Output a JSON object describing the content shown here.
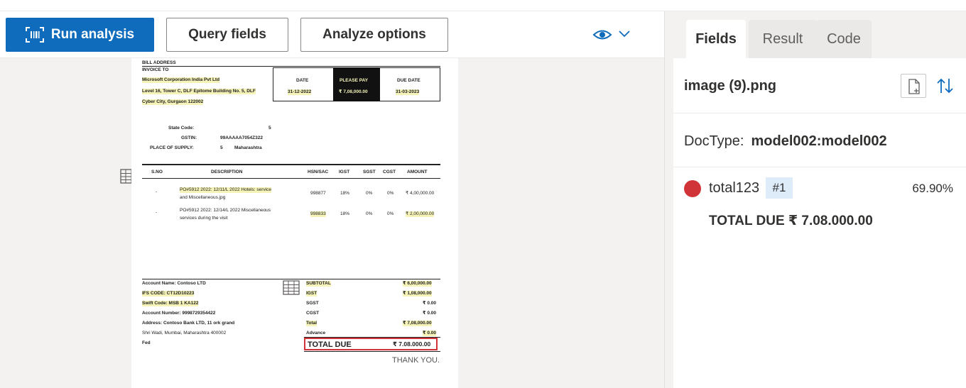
{
  "toolbar": {
    "run_label": "Run analysis",
    "query_label": "Query fields",
    "options_label": "Analyze options"
  },
  "document": {
    "header_small": "BILL ADDRESS",
    "invoice_to": "INVOICE TO",
    "company_line1": "Microsoft Corporation India Pvt Ltd",
    "company_line2": "Level 16, Tower C, DLF Epitome Building No. 5, DLF",
    "company_line3": "Cyber City, Gurgaon 122002",
    "date_label": "DATE",
    "please_pay_label": "PLEASE PAY",
    "due_date_label": "DUE DATE",
    "date_value": "31-12-2022",
    "please_pay_value": "₹ 7,08,000.00",
    "due_date_value": "31-03-2023",
    "state_code_label": "State Code:",
    "state_code_value": "5",
    "gstin_label": "GSTIN:",
    "gstin_value": "99AAAAA7054Z322",
    "place_label": "PLACE OF SUPPLY:",
    "place_code": "5",
    "place_value": "Maharashtra",
    "col_sno": "S.NO",
    "col_desc": "DESCRIPTION",
    "col_hsn": "HSN/SAC",
    "col_igst": "IGST",
    "col_sgst": "SGST",
    "col_cgst": "CGST",
    "col_amount": "AMOUNT",
    "item1_desc1": "PO#5912 2022: 12/11/L 2022 Hotels: service",
    "item1_desc2": "and Miscellaneous.jpg",
    "item1_hsn": "998877",
    "item1_igst": "18%",
    "item1_sgst": "0%",
    "item1_cgst": "0%",
    "item1_amt": "₹ 4,00,000.00",
    "item2_desc1": "PO#5912 2022: 12/14/L 2022 Miscellaneous",
    "item2_desc2": "services during the visit",
    "item2_hsn": "998833",
    "item2_igst": "18%",
    "item2_sgst": "0%",
    "item2_cgst": "0%",
    "item2_amt": "₹ 2,00,000.00",
    "acct_name": "Account Name: Contoso LTD",
    "ifs_code": "IFS CODE: CT12D10223",
    "swift_code": "Swift Code: MSB 1 KA122",
    "acct_number": "Account Number: 9998729354422",
    "address1": "Address: Contoso Bank LTD, 11 ork grand",
    "address2": "Shri Wadi, Mumbai, Maharashtra 400002",
    "misc": "Fed",
    "subtotal_label": "SUBTOTAL",
    "subtotal_value": "₹ 6,00,000.00",
    "igst_label": "IGST",
    "igst_value": "₹ 1,08,000.00",
    "sgst_label": "SGST",
    "sgst_value": "₹ 0.00",
    "cgst_label": "CGST",
    "cgst_value": "₹ 0.00",
    "total_label": "Total",
    "total_value": "₹ 7,08,000.00",
    "advance_label": "Advance",
    "advance_value": "₹ 0.00",
    "total_due_label": "TOTAL DUE",
    "total_due_value": "₹ 7.08.000.00",
    "thank_you": "THANK YOU."
  },
  "tabs": {
    "fields": "Fields",
    "result": "Result",
    "code": "Code"
  },
  "panel": {
    "file_name": "image (9).png",
    "doctype_label": "DocType:",
    "doctype_value": "model002:model002",
    "field": {
      "name": "total123",
      "badge": "#1",
      "confidence": "69.90%",
      "value": "TOTAL DUE ₹ 7.08.000.00",
      "color": "#d13438"
    }
  },
  "colors": {
    "primary": "#0f6cbd",
    "highlight": "#f5f3b8",
    "field_marker": "#d13438"
  }
}
